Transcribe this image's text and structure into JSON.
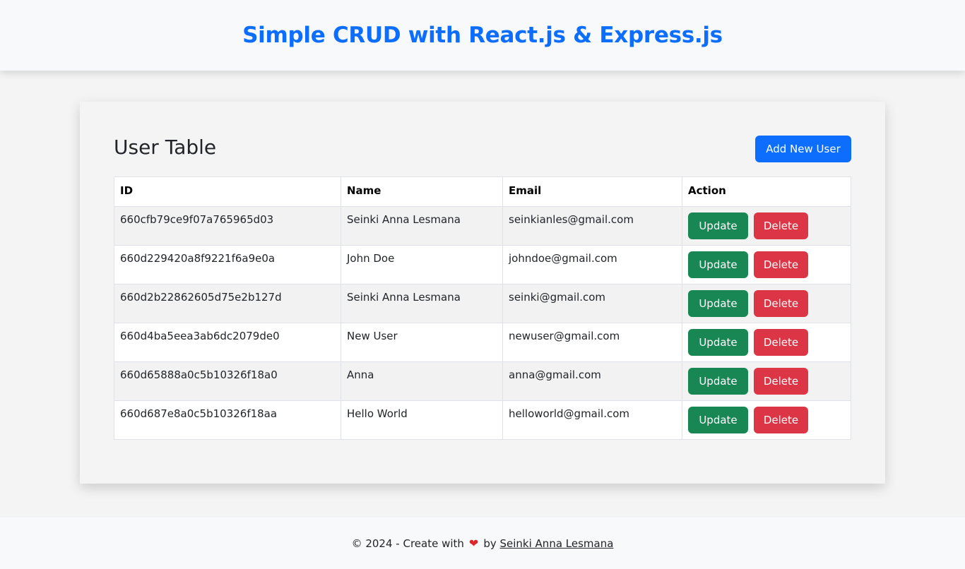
{
  "header": {
    "title": "Simple CRUD with React.js & Express.js"
  },
  "card": {
    "title": "User Table",
    "add_button_label": "Add New User"
  },
  "table": {
    "columns": [
      "ID",
      "Name",
      "Email",
      "Action"
    ],
    "rows": [
      {
        "id": "660cfb79ce9f07a765965d03",
        "name": "Seinki Anna Lesmana",
        "email": "seinkianles@gmail.com"
      },
      {
        "id": "660d229420a8f9221f6a9e0a",
        "name": "John Doe",
        "email": "johndoe@gmail.com"
      },
      {
        "id": "660d2b22862605d75e2b127d",
        "name": "Seinki Anna Lesmana",
        "email": "seinki@gmail.com"
      },
      {
        "id": "660d4ba5eea3ab6dc2079de0",
        "name": "New User",
        "email": "newuser@gmail.com"
      },
      {
        "id": "660d65888a0c5b10326f18a0",
        "name": "Anna",
        "email": "anna@gmail.com"
      },
      {
        "id": "660d687e8a0c5b10326f18aa",
        "name": "Hello World",
        "email": "helloworld@gmail.com"
      }
    ],
    "update_label": "Update",
    "delete_label": "Delete"
  },
  "footer": {
    "prefix": "© 2024 - Create with",
    "heart_icon": "heart-icon",
    "heart_glyph": "❤",
    "by": "by",
    "author_link": "Seinki Anna Lesmana"
  },
  "colors": {
    "primary": "#0d6efd",
    "success": "#198754",
    "danger": "#dc3545"
  }
}
